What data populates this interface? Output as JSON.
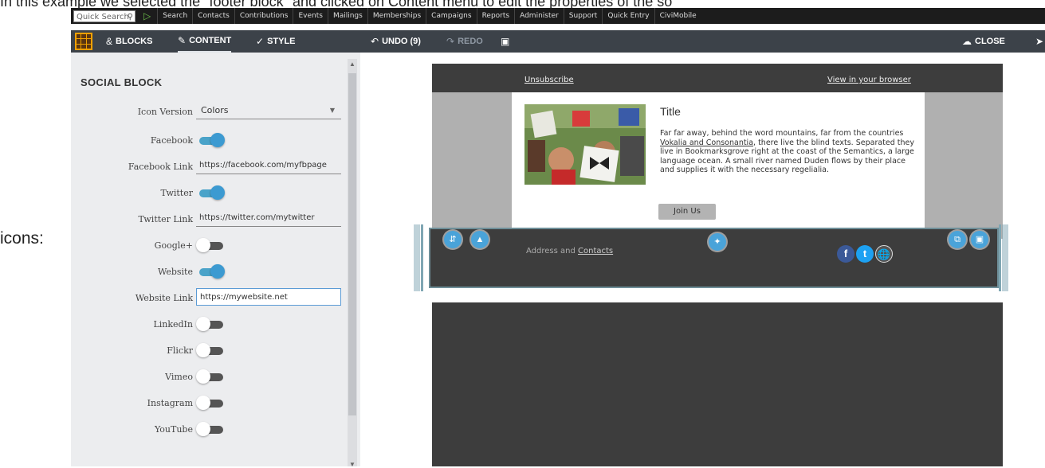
{
  "doc": {
    "intro": "In this example we selected the \"footer block\" and clicked on Content menu to edit the properties of the so",
    "icons_label": "icons:"
  },
  "civi": {
    "quick_search": "Quick Search",
    "menu": [
      "Search",
      "Contacts",
      "Contributions",
      "Events",
      "Mailings",
      "Memberships",
      "Campaigns",
      "Reports",
      "Administer",
      "Support",
      "Quick Entry",
      "CiviMobile"
    ]
  },
  "toolbar": {
    "blocks": "BLOCKS",
    "content": "CONTENT",
    "style": "STYLE",
    "undo": "UNDO (9)",
    "redo": "REDO",
    "close": "CLOSE"
  },
  "panel": {
    "title": "SOCIAL BLOCK",
    "icon_version_label": "Icon Version",
    "icon_version_value": "Colors",
    "rows": [
      {
        "label": "Facebook",
        "on": true
      },
      {
        "label": "Facebook Link",
        "value": "https://facebook.com/myfbpage"
      },
      {
        "label": "Twitter",
        "on": true
      },
      {
        "label": "Twitter Link",
        "value": "https://twitter.com/mytwitter"
      },
      {
        "label": "Google+",
        "on": false
      },
      {
        "label": "Website",
        "on": true
      },
      {
        "label": "Website Link",
        "value": "https://mywebsite.net"
      },
      {
        "label": "LinkedIn",
        "on": false
      },
      {
        "label": "Flickr",
        "on": false
      },
      {
        "label": "Vimeo",
        "on": false
      },
      {
        "label": "Instagram",
        "on": false
      },
      {
        "label": "YouTube",
        "on": false
      }
    ]
  },
  "email": {
    "unsubscribe": "Unsubscribe",
    "view_browser": "View in your browser",
    "card_title": "Title",
    "card_text_1": "Far far away, behind the word mountains, far from the countries ",
    "card_text_link": "Vokalia and Consonantia",
    "card_text_2": ", there live the blind texts. Separated they live in Bookmarksgrove right at the coast of the Semantics, a large language ocean. A small river named Duden flows by their place and supplies it with the necessary regelialia.",
    "join_button": "Join Us",
    "footer_text": "Address and ",
    "footer_link": "Contacts"
  },
  "colors": {
    "toolbar_bg": "#3c4249",
    "accent": "#4aa3d9",
    "email_dark": "#3d3d3d",
    "facebook": "#3b5998",
    "twitter": "#1da1f2"
  }
}
